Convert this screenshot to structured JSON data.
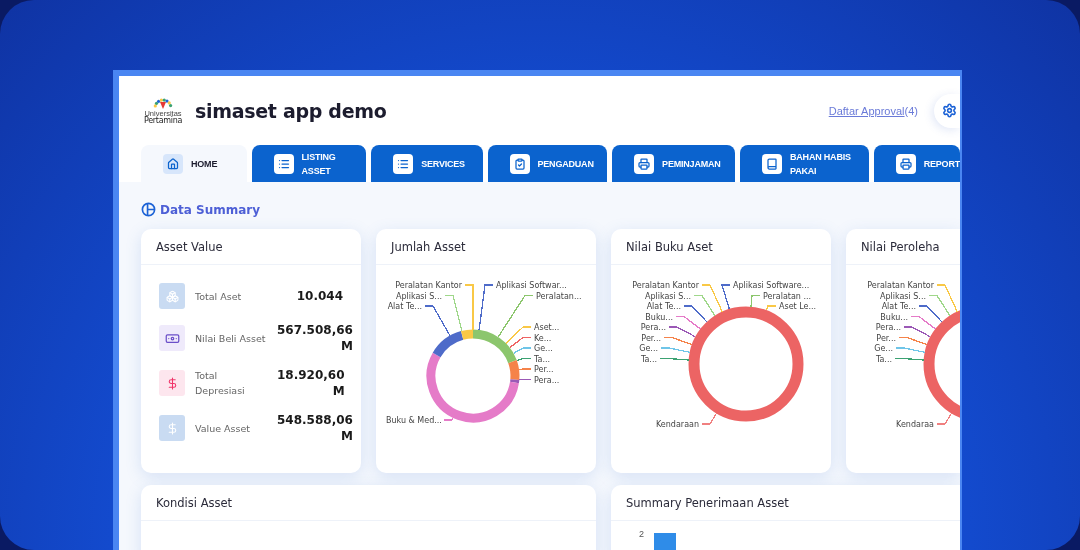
{
  "header": {
    "logo": {
      "line_1": "Universitas",
      "line_2": "Pertamina"
    },
    "title": "simaset app demo",
    "approval_link": "Daftar Approval",
    "approval_count": "(4)"
  },
  "tabs": [
    {
      "label": "HOME",
      "selected": true
    },
    {
      "label": "LISTING ASSET",
      "selected": false
    },
    {
      "label": "SERVICES",
      "selected": false
    },
    {
      "label": "PENGADUAN",
      "selected": false
    },
    {
      "label": "PEMINJAMAN",
      "selected": false
    },
    {
      "label": "BAHAN HABIS PAKAI",
      "selected": false
    },
    {
      "label": "REPORT",
      "selected": false
    }
  ],
  "section_title": "Data Summary",
  "asset_value": {
    "title": "Asset Value",
    "rows": [
      {
        "label": "Total Aset",
        "value": "10.044",
        "kind": "boxes",
        "color": "#c9dbf2"
      },
      {
        "label": "Nilai Beli Asset",
        "value": "567.508,66 M",
        "kind": "money",
        "color": "#efeafb"
      },
      {
        "label": "Total Depresiasi",
        "value": "18.920,60 M",
        "kind": "dollar",
        "color": "#fde6ee"
      },
      {
        "label": "Value Asset",
        "value": "548.588,06 M",
        "kind": "dollar",
        "color": "#c9dbf2"
      }
    ]
  },
  "donut_cards": [
    {
      "title": "Jumlah Asset",
      "kind": "segmented",
      "labels": [
        {
          "text": "Peralatan Kantor",
          "kind": "left",
          "color": "#f9c846"
        },
        {
          "text": "Aplikasi S...",
          "kind": "left",
          "color": "#9fd78a"
        },
        {
          "text": "Alat Te...",
          "kind": "left",
          "color": "#4e6bc9"
        },
        {
          "text": "Aplikasi Softwar...",
          "kind": "right",
          "color": "#4e6bc9"
        },
        {
          "text": "Peralatan...",
          "kind": "right",
          "color": "#8cc66d"
        },
        {
          "text": "Aset...",
          "kind": "right",
          "color": "#f9c846"
        },
        {
          "text": "Ke...",
          "kind": "right",
          "color": "#ef6464"
        },
        {
          "text": "Ge...",
          "kind": "right",
          "color": "#6fc5e8"
        },
        {
          "text": "Ta...",
          "kind": "right",
          "color": "#3ba272"
        },
        {
          "text": "Per...",
          "kind": "right",
          "color": "#f5834a"
        },
        {
          "text": "Pera...",
          "kind": "right",
          "color": "#9b59b6"
        },
        {
          "text": "Buku & Med...",
          "kind": "bottom",
          "color": "#e57bc8"
        }
      ]
    },
    {
      "title": "Nilai Buku Aset",
      "kind": "single",
      "labels": [
        {
          "text": "Peralatan Kantor",
          "kind": "left",
          "color": "#f9c846"
        },
        {
          "text": "Aplikasi S...",
          "kind": "left",
          "color": "#9fd78a"
        },
        {
          "text": "Alat Te...",
          "kind": "left",
          "color": "#4e6bc9"
        },
        {
          "text": "Buku...",
          "kind": "left",
          "color": "#e57bc8"
        },
        {
          "text": "Pera...",
          "kind": "left",
          "color": "#9b59b6"
        },
        {
          "text": "Per...",
          "kind": "left",
          "color": "#f5834a"
        },
        {
          "text": "Ge...",
          "kind": "left",
          "color": "#6fc5e8"
        },
        {
          "text": "Ta...",
          "kind": "left",
          "color": "#3ba272"
        },
        {
          "text": "Aplikasi Software...",
          "kind": "right",
          "color": "#4e6bc9"
        },
        {
          "text": "Peralatan ...",
          "kind": "right",
          "color": "#8cc66d"
        },
        {
          "text": "Aset Le...",
          "kind": "right",
          "color": "#f9c846"
        },
        {
          "text": "Kendaraan",
          "kind": "bottom",
          "color": "#f08080"
        }
      ]
    },
    {
      "title": "Nilai Peroleha",
      "kind": "single",
      "labels": [
        {
          "text": "Peralatan Kantor",
          "kind": "left",
          "color": "#f9c846"
        },
        {
          "text": "Aplikasi S...",
          "kind": "left",
          "color": "#9fd78a"
        },
        {
          "text": "Alat Te...",
          "kind": "left",
          "color": "#4e6bc9"
        },
        {
          "text": "Buku...",
          "kind": "left",
          "color": "#e57bc8"
        },
        {
          "text": "Pera...",
          "kind": "left",
          "color": "#9b59b6"
        },
        {
          "text": "Per...",
          "kind": "left",
          "color": "#f5834a"
        },
        {
          "text": "Ge...",
          "kind": "left",
          "color": "#6fc5e8"
        },
        {
          "text": "Ta...",
          "kind": "left",
          "color": "#3ba272"
        },
        {
          "text": "Kendaraa",
          "kind": "bottom",
          "color": "#f08080"
        }
      ]
    }
  ],
  "bottom_cards": [
    {
      "title": "Kondisi Asset"
    },
    {
      "title": "Summary Penerimaan Asset",
      "y_tick": "2"
    }
  ]
}
